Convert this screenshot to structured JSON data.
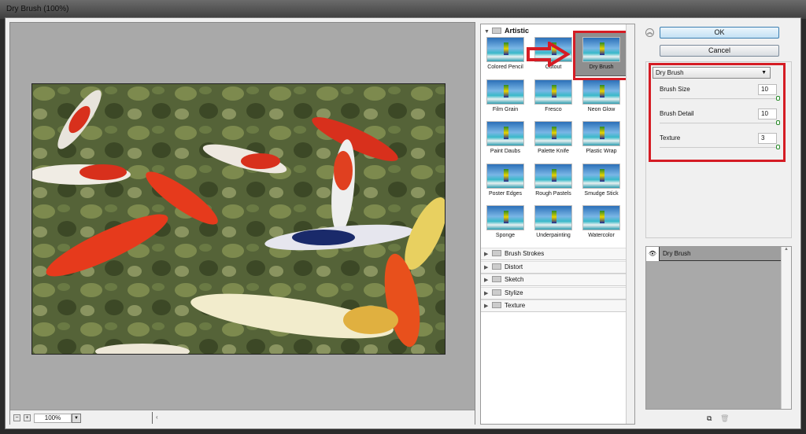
{
  "window": {
    "title": "Dry Brush (100%)"
  },
  "preview": {
    "zoom": "100%",
    "zoom_out": "−",
    "zoom_in": "+",
    "scroll_left": "‹"
  },
  "filters": {
    "categories": [
      {
        "name": "Artistic",
        "expanded": true,
        "items": [
          "Colored Pencil",
          "Cutout",
          "Dry Brush",
          "Film Grain",
          "Fresco",
          "Neon Glow",
          "Paint Daubs",
          "Palette Knife",
          "Plastic Wrap",
          "Poster Edges",
          "Rough Pastels",
          "Smudge Stick",
          "Sponge",
          "Underpainting",
          "Watercolor"
        ],
        "selected": "Dry Brush"
      },
      {
        "name": "Brush Strokes"
      },
      {
        "name": "Distort"
      },
      {
        "name": "Sketch"
      },
      {
        "name": "Stylize"
      },
      {
        "name": "Texture"
      }
    ]
  },
  "buttons": {
    "ok": "OK",
    "cancel": "Cancel"
  },
  "settings": {
    "filter": "Dry Brush",
    "params": [
      {
        "label": "Brush Size",
        "value": "10",
        "fraction": 1.0
      },
      {
        "label": "Brush Detail",
        "value": "10",
        "fraction": 1.0
      },
      {
        "label": "Texture",
        "value": "3",
        "fraction": 1.0
      }
    ]
  },
  "layers": [
    {
      "name": "Dry Brush",
      "visible": true
    }
  ],
  "colors": {
    "highlight": "#d51c24",
    "ok_button": "#c4e1f4"
  }
}
